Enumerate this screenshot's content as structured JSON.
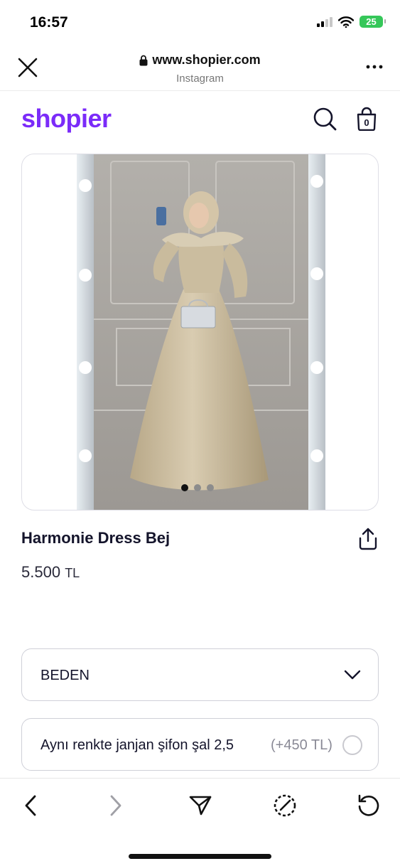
{
  "status_bar": {
    "time": "16:57",
    "battery": "25"
  },
  "browser": {
    "url": "www.shopier.com",
    "subtitle": "Instagram"
  },
  "site": {
    "logo": "shopier"
  },
  "product": {
    "title": "Harmonie Dress Bej",
    "price": "5.500",
    "currency": "TL",
    "image_count": 3,
    "active_image": 1
  },
  "size_select": {
    "label": "BEDEN"
  },
  "option": {
    "label": "Aynı renkte janjan şifon şal 2,5",
    "price": "(+450 TL)"
  },
  "colors": {
    "brand": "#7b2bf9",
    "battery": "#35c759",
    "text": "#14142b"
  },
  "icons": [
    "close-icon",
    "lock-icon",
    "more-icon",
    "search-icon",
    "bag-icon",
    "share-icon",
    "chevron-down-icon",
    "back-icon",
    "forward-icon",
    "send-icon",
    "speed-icon",
    "reload-icon"
  ]
}
